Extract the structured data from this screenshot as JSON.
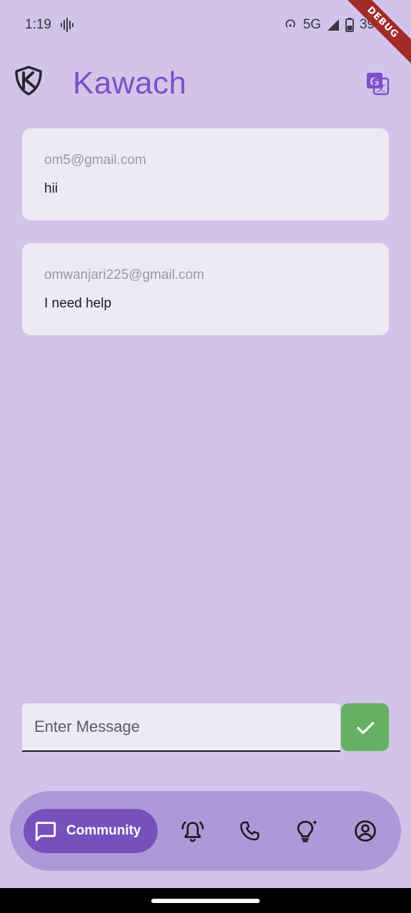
{
  "status_bar": {
    "time": "1:19",
    "network": "5G",
    "battery": "39%",
    "icons": [
      "audio-wave-icon",
      "hotspot-icon",
      "signal-icon",
      "battery-icon"
    ]
  },
  "debug_banner": "DEBUG",
  "app_bar": {
    "title": "Kawach",
    "logo": "kawach-shield-logo",
    "action_icon": "translate-icon"
  },
  "messages": [
    {
      "email": "om5@gmail.com",
      "text": "hii"
    },
    {
      "email": "omwanjari225@gmail.com",
      "text": "I need help"
    }
  ],
  "composer": {
    "placeholder": "Enter Message",
    "value": "",
    "send_icon": "check-icon"
  },
  "bottom_nav": {
    "active_label": "Community",
    "items": [
      {
        "name": "community",
        "icon": "chat-bubble-icon",
        "active": true
      },
      {
        "name": "alerts",
        "icon": "bell-ring-icon",
        "active": false
      },
      {
        "name": "call",
        "icon": "phone-icon",
        "active": false
      },
      {
        "name": "tips",
        "icon": "lightbulb-sparkle-icon",
        "active": false
      },
      {
        "name": "profile",
        "icon": "account-circle-icon",
        "active": false
      }
    ]
  },
  "colors": {
    "background": "#D1C4E8",
    "accent": "#7E4FC8",
    "card": "#EEEAF4",
    "send_button": "#66B061",
    "nav_bar": "#AE99D8",
    "nav_active": "#7651BD",
    "debug_ribbon": "#A52A2A"
  }
}
